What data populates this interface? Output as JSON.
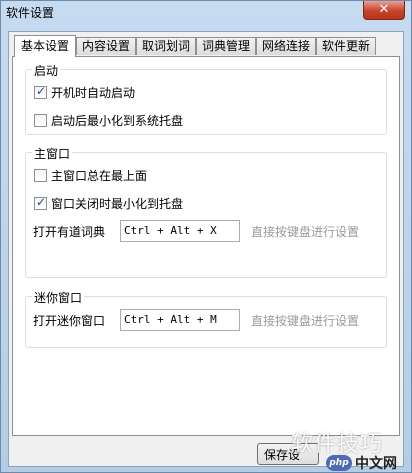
{
  "window": {
    "title": "软件设置",
    "close_symbol": "✕"
  },
  "tabs": [
    {
      "label": "基本设置",
      "active": true
    },
    {
      "label": "内容设置",
      "active": false
    },
    {
      "label": "取词划词",
      "active": false
    },
    {
      "label": "词典管理",
      "active": false
    },
    {
      "label": "网络连接",
      "active": false
    },
    {
      "label": "软件更新",
      "active": false
    }
  ],
  "startup": {
    "title": "启动",
    "options": [
      {
        "label": "开机时自动启动",
        "checked": true
      },
      {
        "label": "启动后最小化到系统托盘",
        "checked": false
      }
    ]
  },
  "main_window": {
    "title": "主窗口",
    "options": [
      {
        "label": "主窗口总在最上面",
        "checked": false
      },
      {
        "label": "窗口关闭时最小化到托盘",
        "checked": true
      }
    ],
    "hotkey_label": "打开有道词典",
    "hotkey_value": "Ctrl + Alt + X",
    "hint": "直接按键盘进行设置"
  },
  "mini_window": {
    "title": "迷你窗口",
    "hotkey_label": "打开迷你窗口",
    "hotkey_value": "Ctrl + Alt + M",
    "hint": "直接按键盘进行设置"
  },
  "buttons": {
    "save_label": "保存设"
  },
  "watermark": {
    "text": "软件技巧",
    "logo_badge": "php",
    "logo_text": "中文网"
  },
  "colors": {
    "check_mark": "#1a4a8a",
    "close_red": "#c7432a",
    "hint_gray": "#9a9a9a"
  }
}
